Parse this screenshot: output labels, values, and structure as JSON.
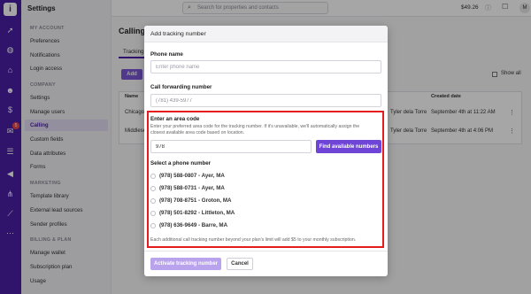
{
  "app": {
    "logo": "i",
    "section_title": "Settings"
  },
  "topbar": {
    "search_placeholder": "Search for properties and contacts",
    "search_icon": "search-icon",
    "credit": "$49.26",
    "avatar_initial": "M"
  },
  "sidebar": {
    "sections": [
      {
        "title": "MY ACCOUNT",
        "items": [
          {
            "label": "Preferences"
          },
          {
            "label": "Notifications"
          },
          {
            "label": "Login access"
          }
        ]
      },
      {
        "title": "COMPANY",
        "items": [
          {
            "label": "Settings"
          },
          {
            "label": "Manage users"
          },
          {
            "label": "Calling"
          },
          {
            "label": "Custom fields"
          },
          {
            "label": "Data attributes"
          },
          {
            "label": "Forms"
          }
        ]
      },
      {
        "title": "MARKETING",
        "items": [
          {
            "label": "Template library"
          },
          {
            "label": "External lead sources"
          },
          {
            "label": "Sender profiles"
          }
        ]
      },
      {
        "title": "BILLING & PLAN",
        "items": [
          {
            "label": "Manage wallet"
          },
          {
            "label": "Subscription plan"
          },
          {
            "label": "Usage"
          }
        ]
      }
    ],
    "active_item": "Calling"
  },
  "rail": {
    "icons": [
      "rocket-icon",
      "globe-icon",
      "home-icon",
      "people-icon",
      "dollar-icon",
      "inbox-icon",
      "list-icon",
      "megaphone-icon",
      "network-icon",
      "chart-icon",
      "more-icon"
    ],
    "badge": "5"
  },
  "page": {
    "heading": "Calling",
    "tab": "Tracking",
    "add_button": "Add",
    "show_all": "Show all",
    "table": {
      "headers": [
        "Name",
        "Created date"
      ],
      "rows": [
        {
          "name": "Chicago",
          "owner": "Tyler dela Torre",
          "created": "September 4th at 11:22 AM"
        },
        {
          "name": "Middlese",
          "owner": "Tyler dela Torre",
          "created": "September 4th at 4:06 PM"
        }
      ]
    }
  },
  "modal": {
    "title": "Add tracking number",
    "phone_name_label": "Phone name",
    "phone_name_placeholder": "Enter phone name",
    "forwarding_label": "Call forwarding number",
    "forwarding_value": "(781) 439-5977",
    "area_code_label": "Enter an area code",
    "area_code_help": "Enter your preferred area code for the tracking number. If it's unavailable, we'll automatically assign the closest available area code based on location.",
    "area_code_value": "978",
    "find_button": "Find available numbers",
    "select_label": "Select a phone number",
    "options": [
      "(978) 588-0807 - Ayer, MA",
      "(978) 588-0731 - Ayer, MA",
      "(978) 708-8751 - Groton, MA",
      "(978) 501-8292 - Littleton, MA",
      "(978) 636-9649 - Barre, MA"
    ],
    "footnote": "Each additional call tracking number beyond your plan's limit will add $5 to your monthly subscription.",
    "activate_button": "Activate tracking number",
    "cancel_button": "Cancel"
  },
  "colors": {
    "brand": "#4b1fa6",
    "accent": "#6f45d8",
    "highlight": "#e41c1c"
  }
}
